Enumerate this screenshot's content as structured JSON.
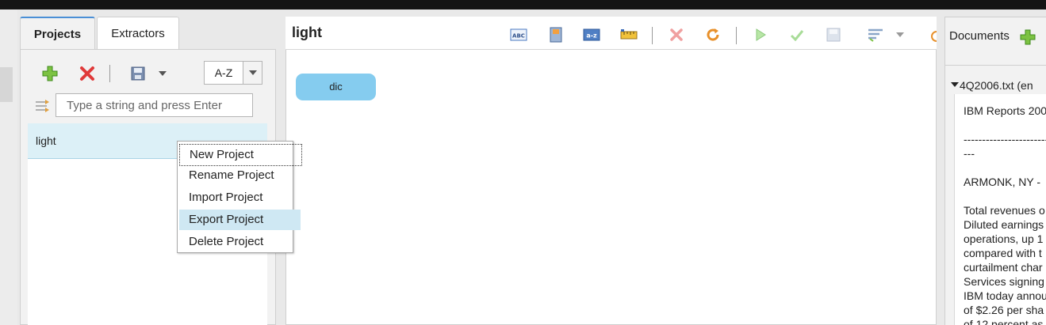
{
  "projects_panel": {
    "tabs": [
      {
        "label": "Projects"
      },
      {
        "label": "Extractors"
      }
    ],
    "toolbar": {
      "add_icon": "plus-icon",
      "delete_icon": "red-x-icon",
      "save_icon": "floppy-disk-icon",
      "sort_value": "A-Z"
    },
    "filter": {
      "placeholder": "Type a string and press Enter",
      "value": ""
    },
    "items": [
      {
        "label": "light",
        "selected": true
      }
    ]
  },
  "context_menu": {
    "items": [
      {
        "label": "New Project",
        "focused": true
      },
      {
        "label": "Rename Project"
      },
      {
        "label": "Import Project"
      },
      {
        "label": "Export Project",
        "hover": true
      },
      {
        "label": "Delete Project"
      }
    ]
  },
  "editor": {
    "title": "light",
    "toolbar_icons": [
      "abc-icon",
      "book-icon",
      "a-z-icon",
      "ruler-icon",
      "delete-icon",
      "refresh-icon",
      "run-icon",
      "check-icon",
      "save-icon",
      "list-icon"
    ],
    "nodes": [
      {
        "label": "dic"
      }
    ]
  },
  "documents_panel": {
    "title": "Documents",
    "add_icon": "plus-icon",
    "document": {
      "name": "4Q2006.txt (en",
      "lines": [
        "IBM Reports 200",
        "",
        "-------------------------",
        "---",
        "",
        "ARMONK, NY - ",
        "",
        "Total revenues o",
        "Diluted earnings",
        "operations, up 1",
        "compared with t",
        "curtailment char",
        "Services signing",
        "IBM today annou",
        "of $2.26 per sha",
        "of 12 percent as"
      ]
    }
  },
  "colors": {
    "accent_tab": "#4a8fd6",
    "selection": "#dcf0f7",
    "node": "#85ccef",
    "menu_highlight": "#cfe8f3"
  }
}
